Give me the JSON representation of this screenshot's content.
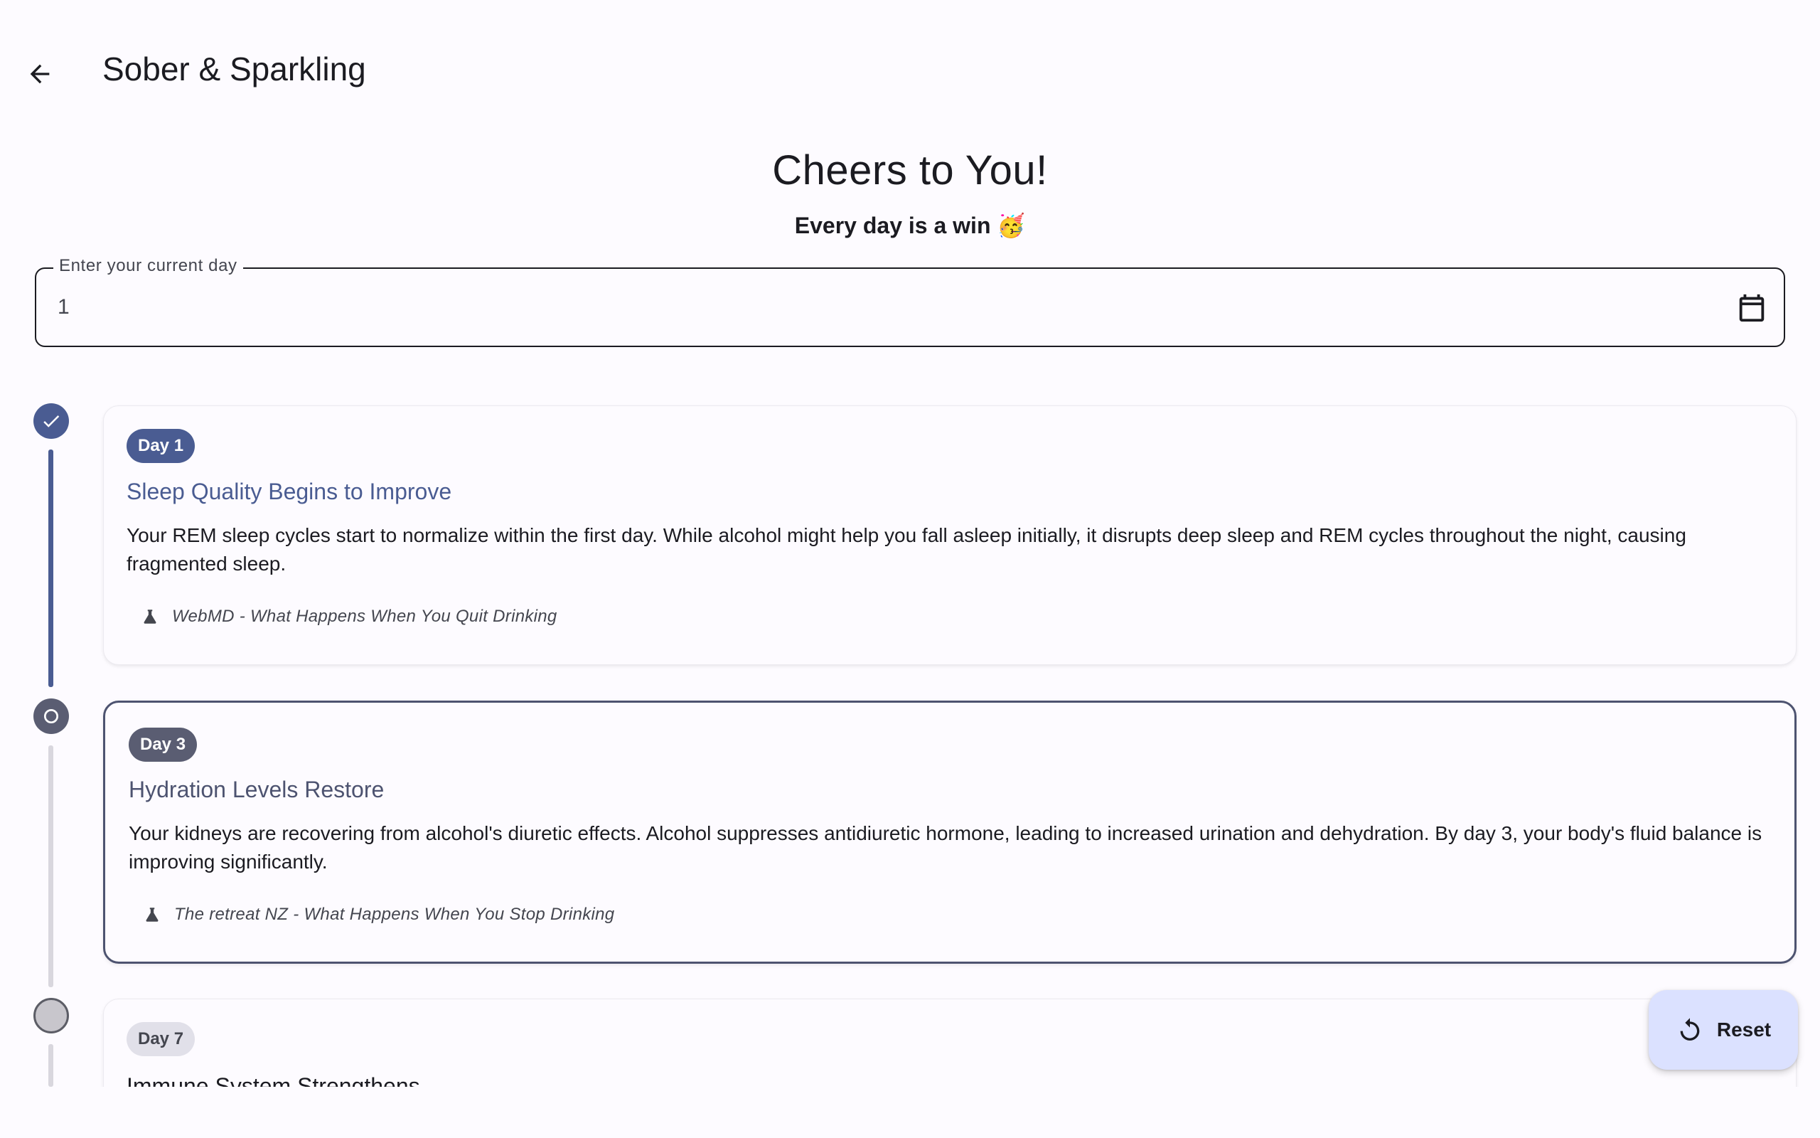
{
  "app": {
    "title": "Sober & Sparkling"
  },
  "header": {
    "title": "Cheers to You!",
    "subtitle": "Every day is a win 🥳"
  },
  "day_field": {
    "label": "Enter your current day",
    "value": "1"
  },
  "milestones": [
    {
      "day_label": "Day 1",
      "status": "completed",
      "title": "Sleep Quality Begins to Improve",
      "body": "Your REM sleep cycles start to normalize within the first day. While alcohol might help you fall asleep initially, it disrupts deep sleep and REM cycles throughout the night, causing fragmented sleep.",
      "source": "WebMD - What Happens When You Quit Drinking"
    },
    {
      "day_label": "Day 3",
      "status": "current",
      "title": "Hydration Levels Restore",
      "body": "Your kidneys are recovering from alcohol's diuretic effects. Alcohol suppresses antidiuretic hormone, leading to increased urination and dehydration. By day 3, your body's fluid balance is improving significantly.",
      "source": "The retreat NZ - What Happens When You Stop Drinking"
    },
    {
      "day_label": "Day 7",
      "status": "upcoming",
      "title": "Immune System Strengthens"
    }
  ],
  "fab": {
    "label": "Reset",
    "icon": "refresh-icon"
  },
  "icons": {
    "back": "arrow-back-icon",
    "calendar": "calendar-icon",
    "source": "flask-icon",
    "check": "check-icon"
  },
  "colors": {
    "primary": "#4a5c92",
    "secondary": "#5a5d72",
    "fab_bg": "#dbe1ff",
    "background": "#fdfbff"
  }
}
